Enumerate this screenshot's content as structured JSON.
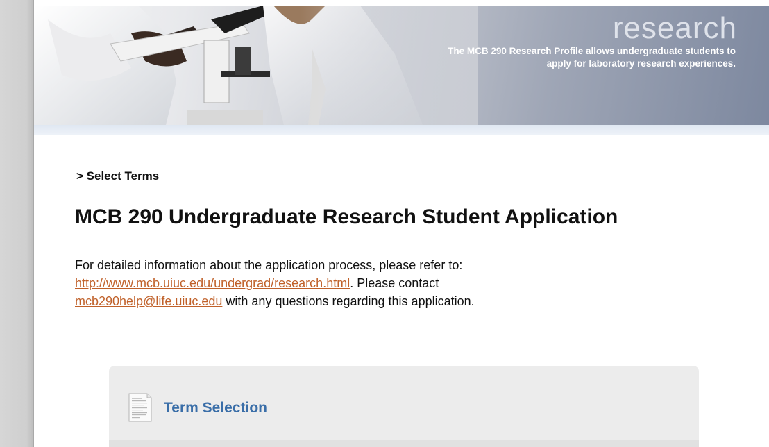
{
  "banner": {
    "title": "research",
    "description": "The MCB 290 Research Profile allows undergraduate students to apply for laboratory research experiences."
  },
  "breadcrumb": "> Select Terms",
  "page_title": "MCB 290 Undergraduate Research Student Application",
  "intro": {
    "text_1": "For detailed information about the application process, please refer to:",
    "link_url_text": "http://www.mcb.uiuc.edu/undergrad/research.html",
    "text_2": ". Please contact",
    "email_link_text": "mcb290help@life.uiuc.edu",
    "text_3": " with any questions regarding this application."
  },
  "term_selection": {
    "title": "Term Selection",
    "icon": "document-icon"
  },
  "colors": {
    "link": "#c0612a",
    "panel_title": "#3a6ea8",
    "panel_bg": "#ececec"
  }
}
